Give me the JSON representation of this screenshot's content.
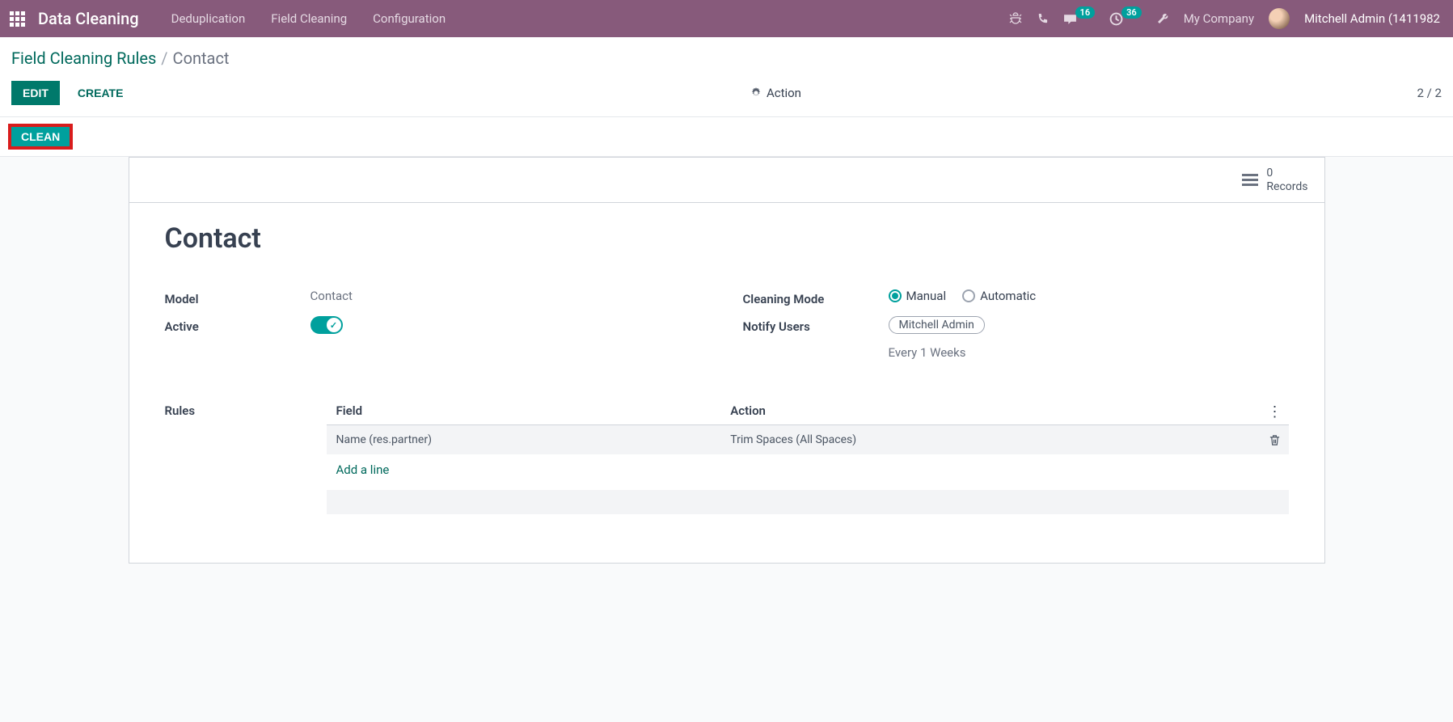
{
  "topbar": {
    "app_title": "Data Cleaning",
    "nav": [
      "Deduplication",
      "Field Cleaning",
      "Configuration"
    ],
    "chat_badge": "16",
    "clock_badge": "36",
    "company": "My Company",
    "user": "Mitchell Admin (1411982"
  },
  "breadcrumb": {
    "parent": "Field Cleaning Rules",
    "current": "Contact"
  },
  "actionbar": {
    "edit": "EDIT",
    "create": "CREATE",
    "action": "Action",
    "pager": "2 / 2"
  },
  "statusbar": {
    "clean": "CLEAN"
  },
  "stat": {
    "count": "0",
    "label": "Records"
  },
  "record": {
    "title": "Contact",
    "labels": {
      "model": "Model",
      "active": "Active",
      "cleaning_mode": "Cleaning Mode",
      "notify_users": "Notify Users",
      "rules": "Rules"
    },
    "model_value": "Contact",
    "cleaning_mode": {
      "manual": "Manual",
      "automatic": "Automatic"
    },
    "notify_user_tag": "Mitchell Admin",
    "notify_freq": "Every  1  Weeks"
  },
  "rules_table": {
    "headers": {
      "field": "Field",
      "action": "Action"
    },
    "row": {
      "field": "Name (res.partner)",
      "action": "Trim Spaces (All Spaces)"
    },
    "add_line": "Add a line"
  }
}
